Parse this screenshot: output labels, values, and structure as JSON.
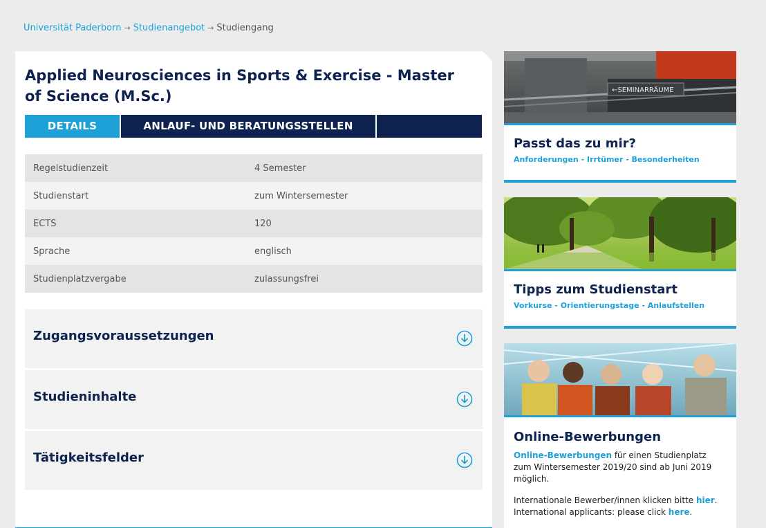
{
  "breadcrumb": {
    "items": [
      "Universität Paderborn",
      "Studienangebot",
      "Studiengang"
    ],
    "separator": "→"
  },
  "page": {
    "title": "Applied Neurosciences in Sports & Exercise - Master of Science (M.Sc.)"
  },
  "tabs": [
    {
      "label": "DETAILS",
      "active": true
    },
    {
      "label": "ANLAUF- UND BERATUNGSSTELLEN",
      "active": false
    },
    {
      "label": "",
      "active": false
    }
  ],
  "facts": [
    {
      "key": "Regelstudienzeit",
      "value": "4 Semester"
    },
    {
      "key": "Studienstart",
      "value": "zum Wintersemester"
    },
    {
      "key": "ECTS",
      "value": "120"
    },
    {
      "key": "Sprache",
      "value": "englisch"
    },
    {
      "key": "Studienplatzvergabe",
      "value": "zulassungsfrei"
    }
  ],
  "accordion": [
    {
      "label": "Zugangsvoraussetzungen",
      "icon": "circle-arrow-down-icon"
    },
    {
      "label": "Studieninhalte",
      "icon": "circle-arrow-down-icon"
    },
    {
      "label": "Tätigkeitsfelder",
      "icon": "circle-arrow-down-icon"
    }
  ],
  "sidebar": {
    "card1": {
      "image_text": "←SEMINARRÄUME",
      "title": "Passt das zu mir?",
      "links": "Anforderungen - Irrtümer - Besonderheiten"
    },
    "card2": {
      "title": "Tipps zum Studienstart",
      "links": "Vorkurse - Orientierungstage - Anlaufstellen"
    },
    "card3": {
      "title": "Online-Bewerbungen",
      "text_link": "Online-Bewerbungen",
      "text_rest": " für einen Studienplatz zum Wintersemester 2019/20 sind ab Juni 2019 möglich.",
      "intl_de_prefix": "Internationale Bewerber/innen klicken bitte ",
      "intl_de_link": "hier",
      "intl_de_suffix": ".",
      "intl_en_prefix": "International applicants: please click ",
      "intl_en_link": "here",
      "intl_en_suffix": "."
    }
  },
  "colors": {
    "accent": "#1da1d6",
    "navy": "#0e2350",
    "background": "#ececec"
  }
}
